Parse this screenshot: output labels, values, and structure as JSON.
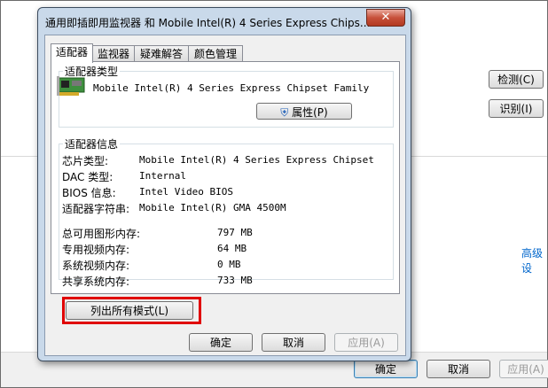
{
  "background_window": {
    "detect_button": "检测(C)",
    "identify_button": "识别(I)",
    "advanced_link": "高级设",
    "ok_button": "确定",
    "cancel_button": "取消",
    "apply_button": "应用(A)"
  },
  "dialog": {
    "title": "通用即插即用监视器 和 Mobile Intel(R) 4 Series Express Chips...",
    "close_glyph": "✕",
    "tabs": [
      {
        "label": "适配器",
        "active": true
      },
      {
        "label": "监视器",
        "active": false
      },
      {
        "label": "疑难解答",
        "active": false
      },
      {
        "label": "颜色管理",
        "active": false
      }
    ],
    "adapter_type": {
      "group_title": "适配器类型",
      "name": "Mobile Intel(R) 4 Series Express Chipset Family",
      "properties_button": "属性(P)"
    },
    "adapter_info": {
      "group_title": "适配器信息",
      "rows": [
        {
          "label": "芯片类型:",
          "value": "Mobile Intel(R) 4 Series Express Chipset"
        },
        {
          "label": "DAC 类型:",
          "value": "Internal"
        },
        {
          "label": "BIOS 信息:",
          "value": "Intel Video BIOS"
        },
        {
          "label": "适配器字符串:",
          "value": "Mobile Intel(R) GMA 4500M"
        }
      ],
      "memory": [
        {
          "label": "总可用图形内存:",
          "value": "797 MB"
        },
        {
          "label": "专用视频内存:",
          "value": "64 MB"
        },
        {
          "label": "系统视频内存:",
          "value": "0 MB"
        },
        {
          "label": "共享系统内存:",
          "value": "733 MB"
        }
      ]
    },
    "list_all_modes_button": "列出所有模式(L)",
    "ok_button": "确定",
    "cancel_button": "取消",
    "apply_button": "应用(A)"
  },
  "colors": {
    "highlight": "#e00000",
    "link": "#0066cc"
  }
}
